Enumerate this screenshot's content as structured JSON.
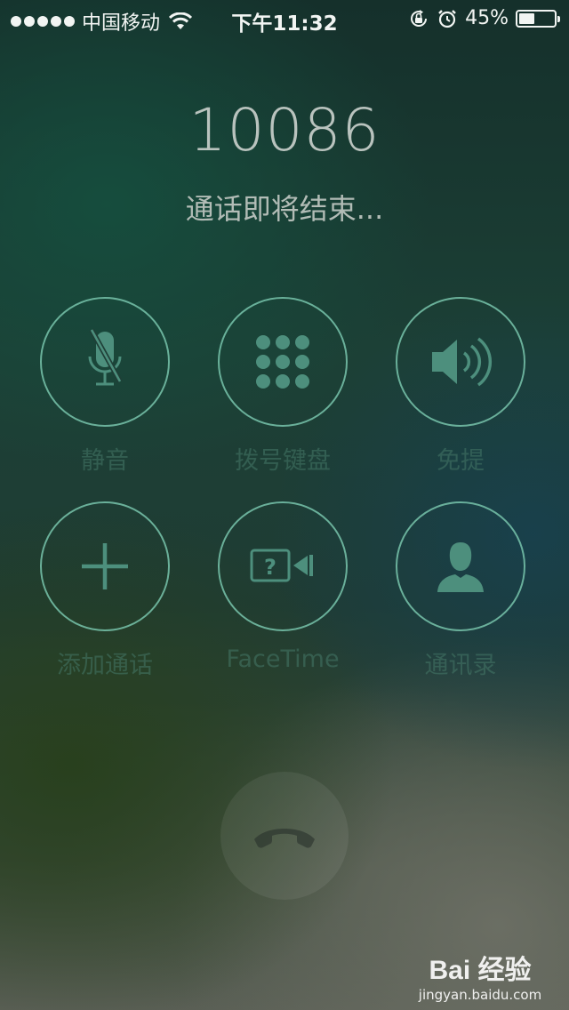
{
  "status_bar": {
    "carrier": "中国移动",
    "time": "下午11:32",
    "battery_text": "45%",
    "battery_level": 0.45
  },
  "call": {
    "number": "10086",
    "status": "通话即将结束..."
  },
  "controls": [
    {
      "label": "静音",
      "icon": "mic-muted-icon"
    },
    {
      "label": "拨号键盘",
      "icon": "keypad-icon"
    },
    {
      "label": "免提",
      "icon": "speaker-icon"
    },
    {
      "label": "添加通话",
      "icon": "plus-icon"
    },
    {
      "label": "FaceTime",
      "icon": "facetime-icon"
    },
    {
      "label": "通讯录",
      "icon": "contact-icon"
    }
  ],
  "end_call": {
    "icon": "phone-hangup-icon"
  },
  "watermark": {
    "logo": "Bai 经验",
    "url": "jingyan.baidu.com"
  },
  "colors": {
    "ring": "#78c4ac",
    "icon": "#4d8f7d"
  }
}
